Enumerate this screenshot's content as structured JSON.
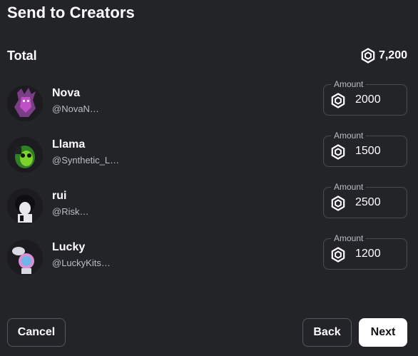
{
  "dialog": {
    "title": "Send to Creators",
    "total_label": "Total",
    "total_amount": "7,200"
  },
  "creators": [
    {
      "name": "Nova",
      "handle": "@NovaN…",
      "amount_label": "Amount",
      "amount": "2000",
      "avatar_colors": [
        "#7a3e86",
        "#c14fc6"
      ]
    },
    {
      "name": "Llama",
      "handle": "@Synthetic_L…",
      "amount_label": "Amount",
      "amount": "1500",
      "avatar_colors": [
        "#2f7f26",
        "#7cd32a"
      ]
    },
    {
      "name": "rui",
      "handle": "@Risk…",
      "amount_label": "Amount",
      "amount": "2500",
      "avatar_colors": [
        "#1d1d1f",
        "#e8e8ea"
      ]
    },
    {
      "name": "Lucky",
      "handle": "@LuckyKits…",
      "amount_label": "Amount",
      "amount": "1200",
      "avatar_colors": [
        "#d9d9e4",
        "#d98fd6"
      ]
    }
  ],
  "buttons": {
    "cancel": "Cancel",
    "back": "Back",
    "next": "Next"
  },
  "icons": {
    "currency": "robux-icon"
  },
  "colors": {
    "background": "#232428",
    "text_secondary": "#bcbec8",
    "field_border": "#4a4c52",
    "primary_button_bg": "#ffffff"
  }
}
